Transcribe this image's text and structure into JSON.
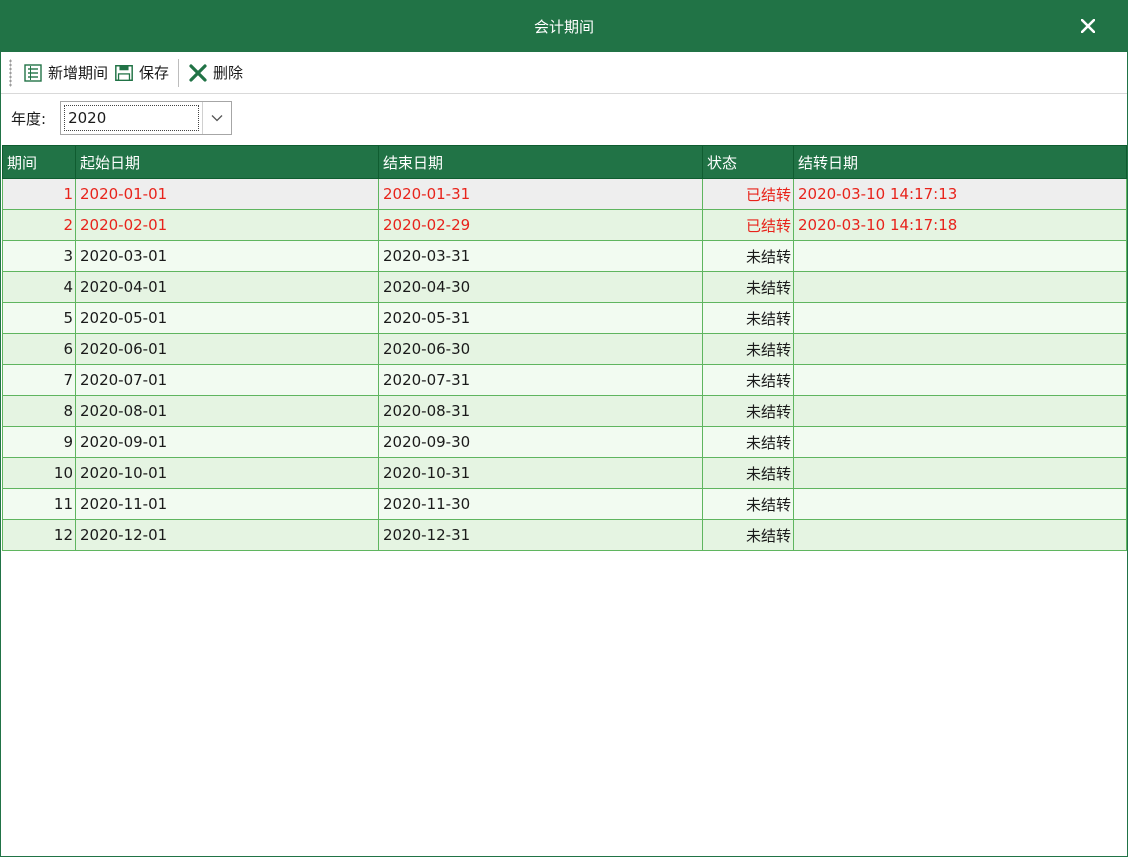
{
  "window": {
    "title": "会计期间"
  },
  "toolbar": {
    "add_label": "新增期间",
    "save_label": "保存",
    "delete_label": "删除"
  },
  "filter": {
    "year_label": "年度:",
    "year_value": "2020"
  },
  "table": {
    "headers": [
      "期间",
      "起始日期",
      "结束日期",
      "状态",
      "结转日期"
    ],
    "rows": [
      {
        "period": "1",
        "start": "2020-01-01",
        "end": "2020-01-31",
        "status": "已结转",
        "closed_at": "2020-03-10 14:17:13"
      },
      {
        "period": "2",
        "start": "2020-02-01",
        "end": "2020-02-29",
        "status": "已结转",
        "closed_at": "2020-03-10 14:17:18"
      },
      {
        "period": "3",
        "start": "2020-03-01",
        "end": "2020-03-31",
        "status": "未结转",
        "closed_at": ""
      },
      {
        "period": "4",
        "start": "2020-04-01",
        "end": "2020-04-30",
        "status": "未结转",
        "closed_at": ""
      },
      {
        "period": "5",
        "start": "2020-05-01",
        "end": "2020-05-31",
        "status": "未结转",
        "closed_at": ""
      },
      {
        "period": "6",
        "start": "2020-06-01",
        "end": "2020-06-30",
        "status": "未结转",
        "closed_at": ""
      },
      {
        "period": "7",
        "start": "2020-07-01",
        "end": "2020-07-31",
        "status": "未结转",
        "closed_at": ""
      },
      {
        "period": "8",
        "start": "2020-08-01",
        "end": "2020-08-31",
        "status": "未结转",
        "closed_at": ""
      },
      {
        "period": "9",
        "start": "2020-09-01",
        "end": "2020-09-30",
        "status": "未结转",
        "closed_at": ""
      },
      {
        "period": "10",
        "start": "2020-10-01",
        "end": "2020-10-31",
        "status": "未结转",
        "closed_at": ""
      },
      {
        "period": "11",
        "start": "2020-11-01",
        "end": "2020-11-30",
        "status": "未结转",
        "closed_at": ""
      },
      {
        "period": "12",
        "start": "2020-12-01",
        "end": "2020-12-31",
        "status": "未结转",
        "closed_at": ""
      }
    ]
  },
  "colors": {
    "brand": "#217346",
    "closed_text": "#e8231b",
    "row_odd": "#f2fbf1",
    "row_even": "#e5f4e2",
    "grid_line": "#5fb55f"
  },
  "icons": {
    "close": "close-icon",
    "add": "list-add-icon",
    "save": "save-icon",
    "delete": "delete-x-icon",
    "dropdown": "chevron-down-icon"
  }
}
